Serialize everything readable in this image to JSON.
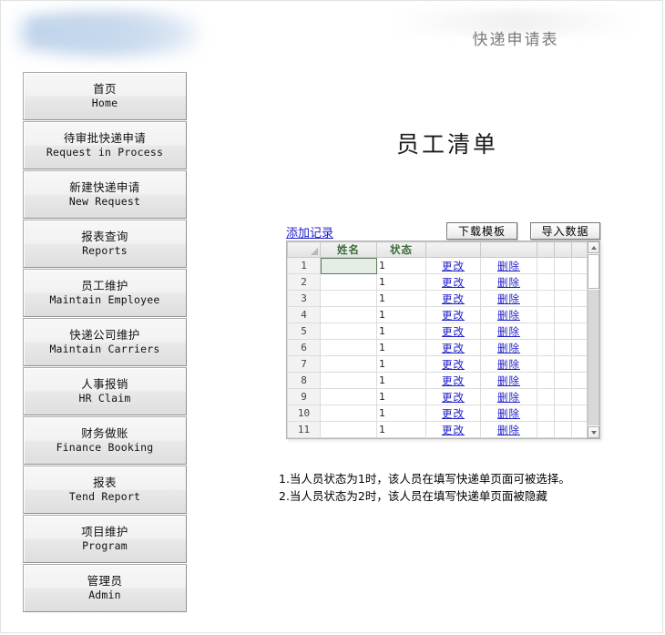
{
  "header": {
    "app_title": "快递申请表",
    "logo_alt": "blurred-company-logo"
  },
  "sidebar": {
    "items": [
      {
        "cn": "首页",
        "en": "Home"
      },
      {
        "cn": "待审批快递申请",
        "en": "Request in Process"
      },
      {
        "cn": "新建快递申请",
        "en": "New Request"
      },
      {
        "cn": "报表查询",
        "en": "Reports"
      },
      {
        "cn": "员工维护",
        "en": "Maintain Employee"
      },
      {
        "cn": "快递公司维护",
        "en": "Maintain Carriers"
      },
      {
        "cn": "人事报销",
        "en": "HR Claim"
      },
      {
        "cn": "财务做账",
        "en": "Finance Booking"
      },
      {
        "cn": "报表",
        "en": "Tend Report"
      },
      {
        "cn": "项目维护",
        "en": "Program"
      },
      {
        "cn": "管理员",
        "en": "Admin"
      }
    ]
  },
  "main": {
    "page_title": "员工清单",
    "toolbar": {
      "add_record_label": "添加记录",
      "download_template_label": "下载模板",
      "import_data_label": "导入数据"
    },
    "grid": {
      "columns": [
        "",
        "姓名",
        "状态",
        "",
        "",
        "",
        "",
        ""
      ],
      "headers": {
        "name": "姓名",
        "status": "状态"
      },
      "edit_label": "更改",
      "delete_label": "删除",
      "selected_row": 1,
      "rows": [
        {
          "index": "1",
          "name": "",
          "status": "1"
        },
        {
          "index": "2",
          "name": "",
          "status": "1"
        },
        {
          "index": "3",
          "name": "",
          "status": "1"
        },
        {
          "index": "4",
          "name": "",
          "status": "1"
        },
        {
          "index": "5",
          "name": "",
          "status": "1"
        },
        {
          "index": "6",
          "name": "",
          "status": "1"
        },
        {
          "index": "7",
          "name": "",
          "status": "1"
        },
        {
          "index": "8",
          "name": "",
          "status": "1"
        },
        {
          "index": "9",
          "name": "",
          "status": "1"
        },
        {
          "index": "10",
          "name": "",
          "status": "1"
        },
        {
          "index": "11",
          "name": "",
          "status": "1"
        }
      ]
    },
    "notes": [
      "1.当人员状态为1时，该人员在填写快递单页面可被选择。",
      "2.当人员状态为2时，该人员在填写快递单页面被隐藏"
    ]
  },
  "colors": {
    "link": "#2121c9",
    "header_text": "#7b7b7b",
    "grid_header_text": "#3a6b3a"
  }
}
